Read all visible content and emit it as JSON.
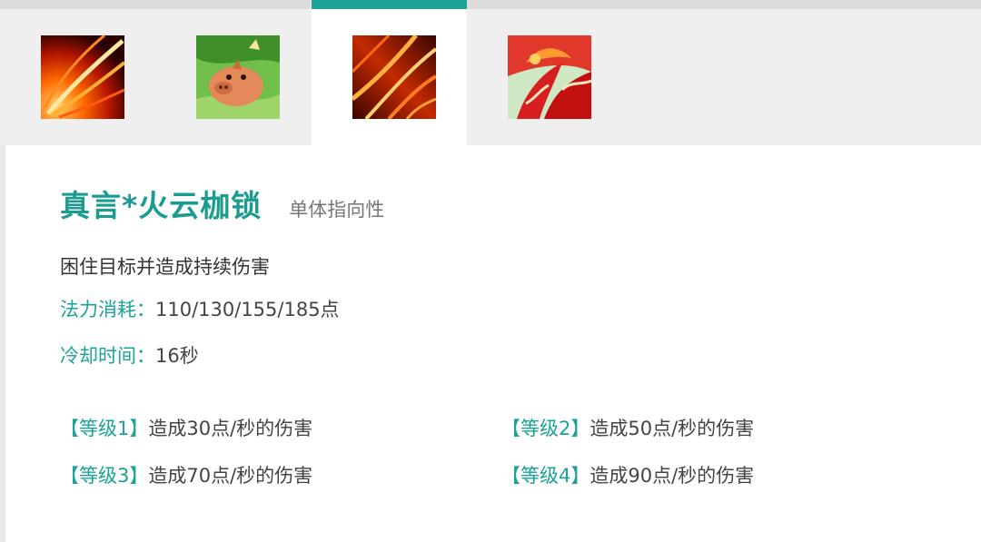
{
  "tabs": [
    {
      "icon": "fire-streak-icon",
      "active": false
    },
    {
      "icon": "pig-icon",
      "active": false
    },
    {
      "icon": "fire-chains-icon",
      "active": true
    },
    {
      "icon": "phoenix-icon",
      "active": false
    }
  ],
  "skill": {
    "name": "真言*火云枷锁",
    "type": "单体指向性",
    "description": "困住目标并造成持续伤害",
    "mana_label": "法力消耗：",
    "mana_value": "110/130/155/185点",
    "cooldown_label": "冷却时间：",
    "cooldown_value": "16秒"
  },
  "levels": [
    {
      "label": "【等级1】",
      "text": "造成30点/秒的伤害"
    },
    {
      "label": "【等级2】",
      "text": "造成50点/秒的伤害"
    },
    {
      "label": "【等级3】",
      "text": "造成70点/秒的伤害"
    },
    {
      "label": "【等级4】",
      "text": "造成90点/秒的伤害"
    }
  ],
  "colors": {
    "accent": "#1aa396",
    "tab_bar": "#efefef",
    "tab_top": "#dcdcdc"
  }
}
